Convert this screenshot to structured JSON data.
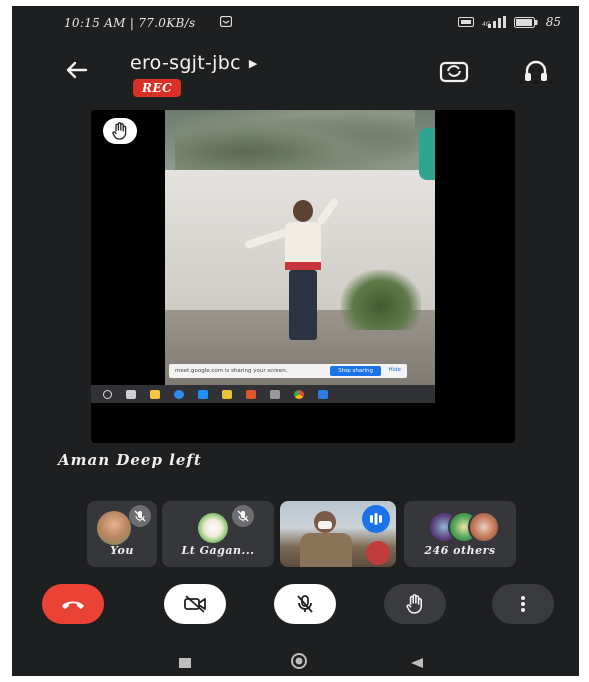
{
  "status_bar": {
    "time_speed": "10:15 AM | 77.0KB/s",
    "battery": "85"
  },
  "header": {
    "meeting_code": "ero-sgjt-jbc",
    "rec_label": "REC"
  },
  "presentation": {
    "share_notice": "meet.google.com is sharing your screen.",
    "stop_sharing_label": "Stop sharing",
    "hide_label": "Hide"
  },
  "notice": {
    "text": "Aman Deep left"
  },
  "participants": [
    {
      "label": "You",
      "muted": true
    },
    {
      "label": "Lt Gagan...",
      "muted": true
    },
    {
      "label": "",
      "speaking": true
    },
    {
      "label": "246 others"
    }
  ],
  "controls": {
    "end_call": "end-call-icon",
    "camera": "camera-off-icon",
    "mic": "mic-off-icon",
    "raise_hand": "raise-hand-icon",
    "more": "more-vertical-icon"
  },
  "colors": {
    "background": "#1e1f20",
    "end_call": "#ea4335",
    "rec": "#d93025",
    "accent": "#1a73e8"
  }
}
